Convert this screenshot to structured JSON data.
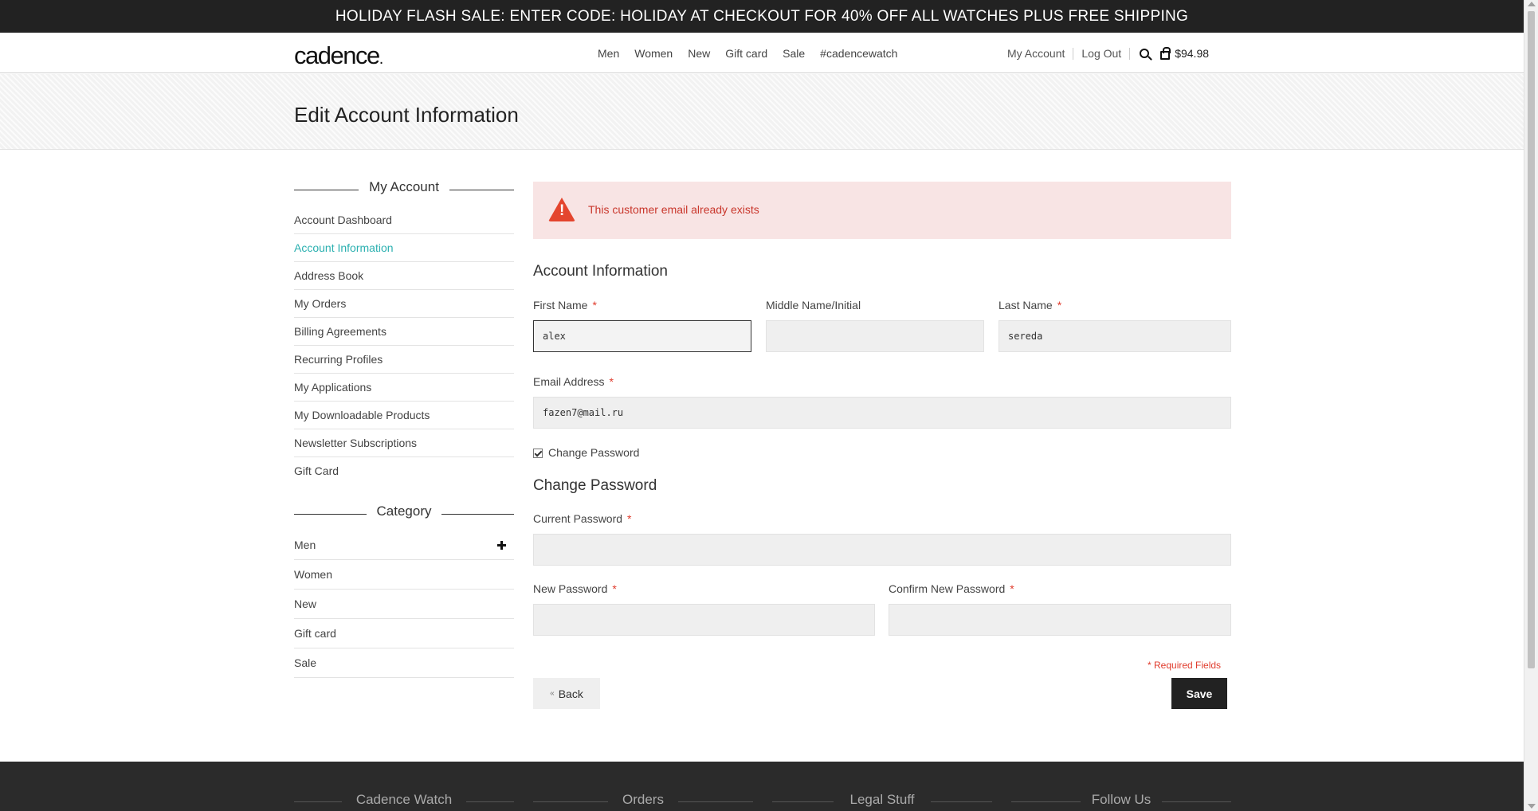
{
  "promo_banner": "HOLIDAY FLASH SALE: ENTER CODE: HOLIDAY AT CHECKOUT FOR 40% OFF ALL WATCHES PLUS FREE SHIPPING",
  "header": {
    "logo": "cadence",
    "logo_dot": ".",
    "nav": [
      "Men",
      "Women",
      "New",
      "Gift card",
      "Sale",
      "#cadencewatch"
    ],
    "my_account": "My Account",
    "log_out": "Log Out",
    "cart_total": "$94.98"
  },
  "page_title": "Edit Account Information",
  "sidebar": {
    "account_title": "My Account",
    "account_items": [
      "Account Dashboard",
      "Account Information",
      "Address Book",
      "My Orders",
      "Billing Agreements",
      "Recurring Profiles",
      "My Applications",
      "My Downloadable Products",
      "Newsletter Subscriptions",
      "Gift Card"
    ],
    "active_item": "Account Information",
    "category_title": "Category",
    "category_items": [
      "Men",
      "Women",
      "New",
      "Gift card",
      "Sale"
    ]
  },
  "alert": {
    "message": "This customer email already exists",
    "icon_glyph": "!"
  },
  "form": {
    "account_info_title": "Account Information",
    "first_name_label": "First Name",
    "first_name_value": "alex",
    "middle_name_label": "Middle Name/Initial",
    "middle_name_value": "",
    "last_name_label": "Last Name",
    "last_name_value": "sereda",
    "email_label": "Email Address",
    "email_value": "fazen7@mail.ru",
    "change_password_checkbox": "Change Password",
    "change_password_checked": true,
    "change_password_title": "Change Password",
    "current_password_label": "Current Password",
    "new_password_label": "New Password",
    "confirm_password_label": "Confirm New Password",
    "required_marker": "*",
    "required_note": "* Required Fields",
    "back_label": "Back",
    "back_arrow": "«",
    "save_label": "Save"
  },
  "footer": {
    "columns": [
      "Cadence Watch",
      "Orders",
      "Legal Stuff",
      "Follow Us"
    ]
  },
  "colors": {
    "promo_bg": "#222222",
    "active_link": "#2bb0b0",
    "alert_bg": "#f8e4e4",
    "alert_text": "#c9372c",
    "required": "#e03b2c",
    "save_bg": "#222222",
    "footer_bg": "#2b2b2b"
  }
}
